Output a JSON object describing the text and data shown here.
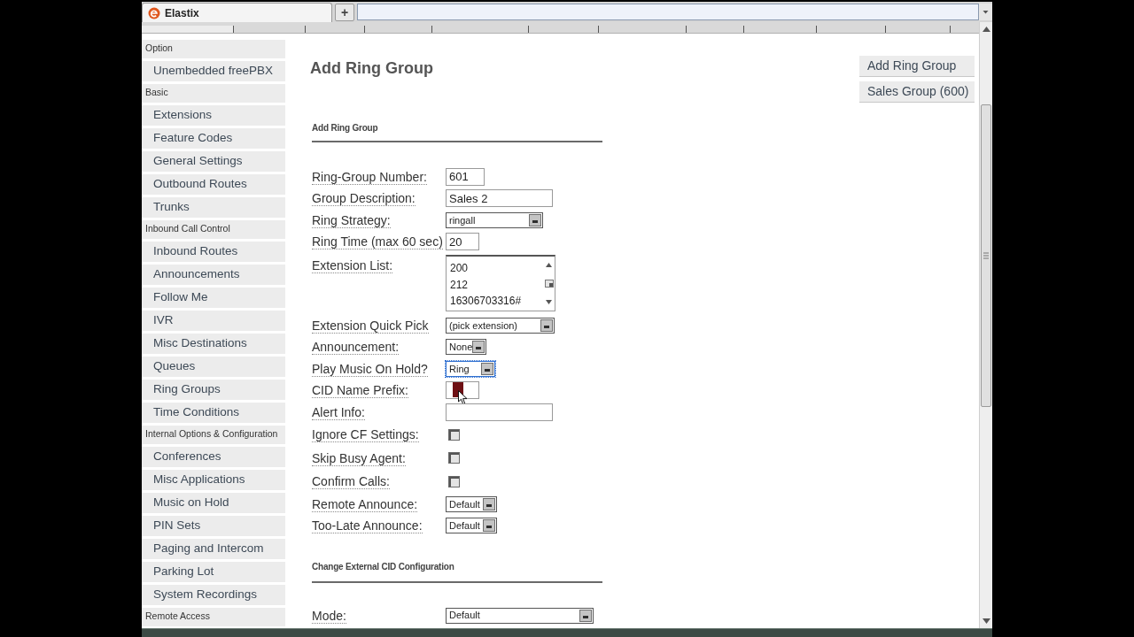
{
  "browser": {
    "tab": {
      "title": "Elastix"
    },
    "new_tab_button": {
      "label": "+"
    }
  },
  "sidebar": {
    "sections": [
      {
        "heading": "Option",
        "items": [
          {
            "label": "Unembedded freePBX",
            "selected": false
          }
        ]
      },
      {
        "heading": "Basic",
        "items": [
          {
            "label": "Extensions",
            "selected": false
          },
          {
            "label": "Feature Codes",
            "selected": false
          },
          {
            "label": "General Settings",
            "selected": false
          },
          {
            "label": "Outbound Routes",
            "selected": false
          },
          {
            "label": "Trunks",
            "selected": false
          }
        ]
      },
      {
        "heading": "Inbound Call Control",
        "items": [
          {
            "label": "Inbound Routes",
            "selected": false
          },
          {
            "label": "Announcements",
            "selected": false
          },
          {
            "label": "Follow Me",
            "selected": false
          },
          {
            "label": "IVR",
            "selected": false
          },
          {
            "label": "Misc Destinations",
            "selected": false
          },
          {
            "label": "Queues",
            "selected": false
          },
          {
            "label": "Ring Groups",
            "selected": false
          },
          {
            "label": "Time Conditions",
            "selected": false
          }
        ]
      },
      {
        "heading": "Internal Options & Configuration",
        "items": [
          {
            "label": "Conferences",
            "selected": false
          },
          {
            "label": "Misc Applications",
            "selected": false
          },
          {
            "label": "Music on Hold",
            "selected": false
          },
          {
            "label": "PIN Sets",
            "selected": false
          },
          {
            "label": "Paging and Intercom",
            "selected": false
          },
          {
            "label": "Parking Lot",
            "selected": false
          },
          {
            "label": "System Recordings",
            "selected": false
          }
        ]
      },
      {
        "heading": "Remote Access"
      }
    ]
  },
  "page": {
    "title": "Add Ring Group",
    "actions": [
      {
        "label": "Add Ring Group"
      },
      {
        "label": "Sales Group (600)"
      }
    ]
  },
  "form": {
    "sections": [
      {
        "heading": "Add Ring Group",
        "fields": [
          {
            "label": "Ring-Group Number:",
            "kind": "text",
            "value": "601",
            "focused": false
          },
          {
            "label": "Group Description:",
            "kind": "text",
            "value": "Sales 2",
            "focused": false
          },
          {
            "label": "Ring Strategy:",
            "kind": "select",
            "value": "ringall",
            "focused": false
          },
          {
            "label": "Ring Time (max 60 sec)",
            "kind": "text",
            "value": "20",
            "focused": false
          },
          {
            "label": "Extension List:",
            "kind": "textarea",
            "lines": [
              "200",
              "212",
              "16306703316#"
            ],
            "focused": false
          },
          {
            "label": "Extension Quick Pick",
            "kind": "select",
            "value": "(pick extension)",
            "focused": false
          },
          {
            "label": "Announcement:",
            "kind": "select",
            "value": "None",
            "focused": false
          },
          {
            "label": "Play Music On Hold?",
            "kind": "select",
            "value": "Ring",
            "focused": true
          },
          {
            "label": "CID Name Prefix:",
            "kind": "text",
            "focused": false
          },
          {
            "label": "Alert Info:",
            "kind": "text",
            "focused": false
          },
          {
            "label": "Ignore CF Settings:",
            "kind": "checkbox",
            "checked": false,
            "focused": false
          },
          {
            "label": "Skip Busy Agent:",
            "kind": "checkbox",
            "checked": false,
            "focused": false
          },
          {
            "label": "Confirm Calls:",
            "kind": "checkbox",
            "checked": false,
            "focused": false
          },
          {
            "label": "Remote Announce:",
            "kind": "select",
            "value": "Default",
            "focused": false
          },
          {
            "label": "Too-Late Announce:",
            "kind": "select",
            "value": "Default",
            "focused": false
          }
        ]
      },
      {
        "heading": "Change External CID Configuration",
        "fields": [
          {
            "label": "Mode:",
            "kind": "select",
            "value": "Default",
            "focused": false
          }
        ]
      }
    ]
  }
}
